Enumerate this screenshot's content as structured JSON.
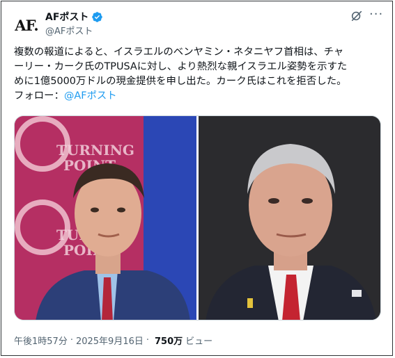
{
  "account": {
    "avatar_text": "AF.",
    "display_name": "AFポスト",
    "handle": "@AFポスト"
  },
  "post": {
    "lines": [
      "複数の報道によると、イスラエルのベンヤミン・ネタニヤフ首相は、チャ",
      "ーリー・カーク氏のTPUSAに対し、より熱烈な親イスラエル姿勢を示すた",
      "めに1億5000万ドルの現金提供を申し出た。カーク氏はこれを拒否した。"
    ],
    "follow_prefix": "フォロー：",
    "follow_mention": "@AFポスト"
  },
  "media": {
    "left_sign_text": [
      "TURNING",
      "POINT",
      "TURNING",
      "POINT"
    ]
  },
  "meta": {
    "time": "午後1時57分",
    "date": "2025年9月16日",
    "separator": "·",
    "views_count": "750万",
    "views_label": "ビュー"
  },
  "colors": {
    "link": "#1d9bf0",
    "verified": "#1d9bf0",
    "secondary_text": "#536471"
  },
  "icons": [
    "verified-badge-icon",
    "grok-icon",
    "more-options-icon"
  ]
}
